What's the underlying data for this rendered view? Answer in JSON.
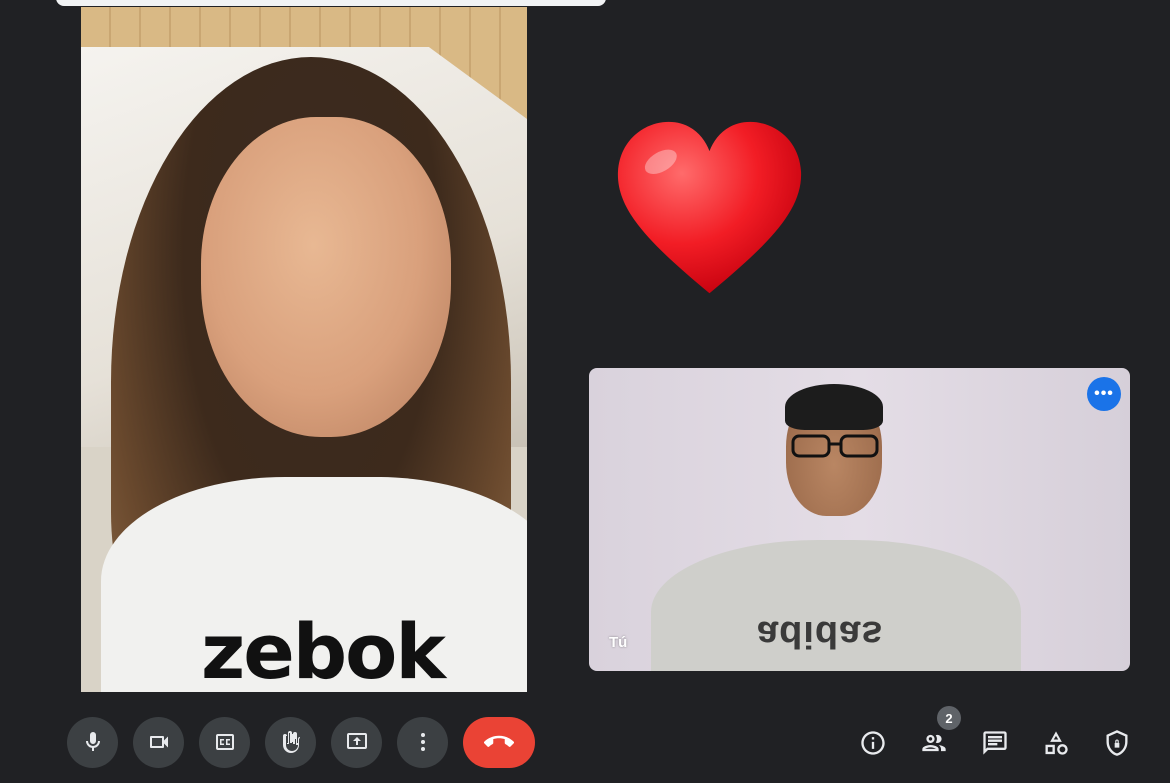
{
  "participants": {
    "main": {
      "shirt_print": "zebok"
    },
    "self": {
      "label": "Tú",
      "shirt_text": "adidas",
      "menu_icon": "more-horiz-icon"
    }
  },
  "reaction": {
    "emoji": "heart",
    "color": "#ff1f2d"
  },
  "controls": [
    {
      "icon": "mic-icon"
    },
    {
      "icon": "camera-icon"
    },
    {
      "icon": "captions-icon"
    },
    {
      "icon": "raise-hand-icon"
    },
    {
      "icon": "present-icon"
    },
    {
      "icon": "more-vert-icon"
    },
    {
      "icon": "end-call-icon",
      "color": "#ea4335"
    }
  ],
  "tools": {
    "people_count": "2",
    "icons": [
      "info-icon",
      "people-icon",
      "chat-icon",
      "activities-icon",
      "host-controls-icon"
    ]
  },
  "colors": {
    "background": "#202124",
    "button": "#3c4043",
    "accent": "#1a73e8"
  }
}
